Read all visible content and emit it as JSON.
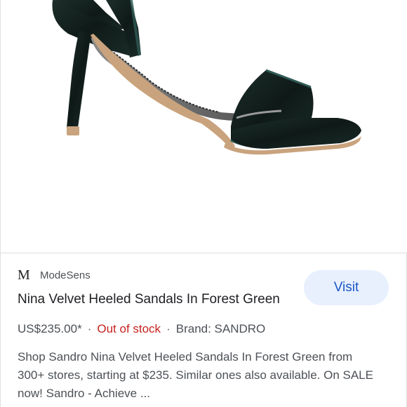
{
  "image": {
    "alt": "Nina Velvet Heeled Sandals In Forest Green",
    "icon": "sandal-image"
  },
  "result": {
    "source_logo": "M",
    "source_name": "ModeSens",
    "title": "Nina Velvet Heeled Sandals In Forest Green",
    "visit_label": "Visit",
    "price": "US$235.00*",
    "separator": "·",
    "stock_status": "Out of stock",
    "brand": "Brand: SANDRO",
    "snippet": "Shop Sandro Nina Velvet Heeled Sandals In Forest Green from 300+ stores, starting at $235. Similar ones also available. On SALE now! Sandro - Achieve ..."
  },
  "colors": {
    "visit_bg": "#e8f0fe",
    "visit_text": "#1a56c4",
    "out_of_stock": "#c5221f",
    "velvet": "#13201d"
  }
}
